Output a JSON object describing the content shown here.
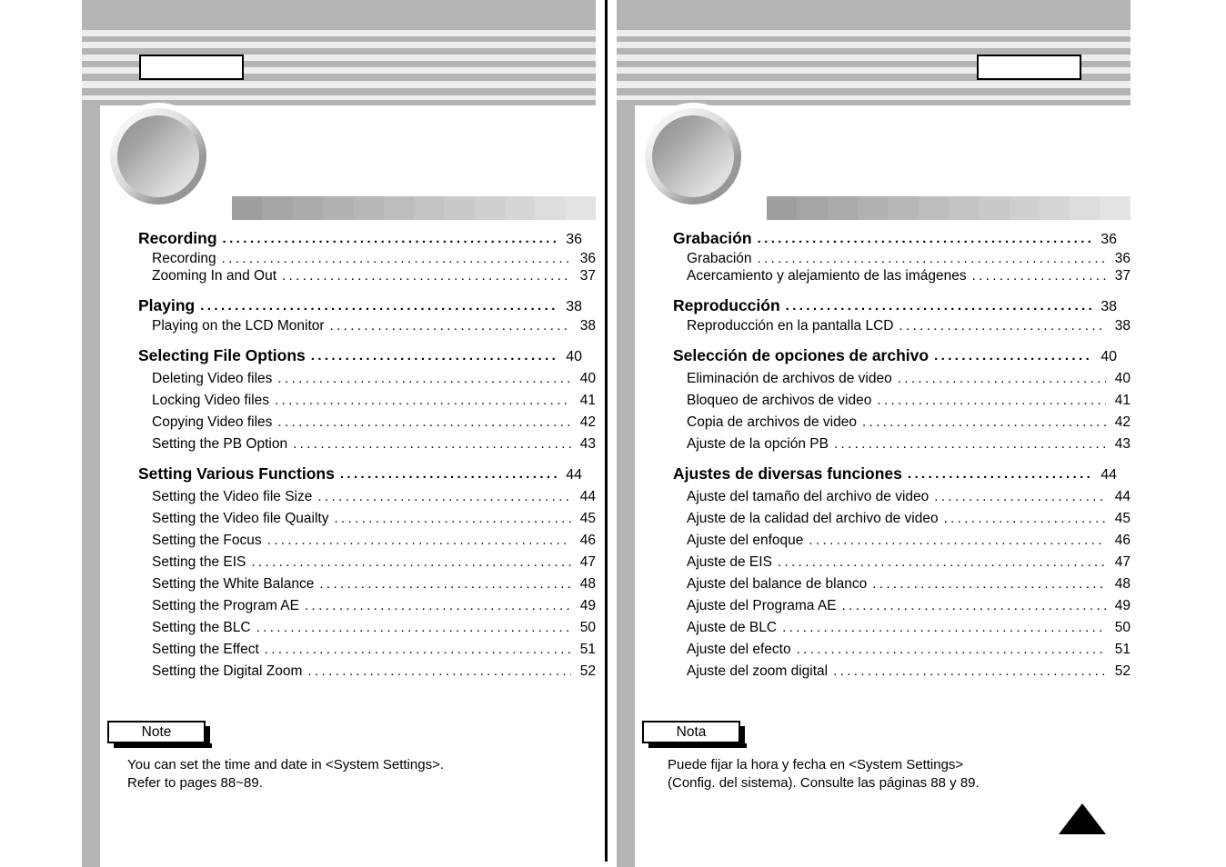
{
  "document": {
    "type": "manual-table-of-contents",
    "colors": {
      "stripe_dark": "#b4b4b4",
      "stripe_light": "#ededed",
      "ink": "#000000",
      "page": "#ffffff"
    }
  },
  "gradient_bar_steps": [
    "#9e9e9e",
    "#a5a5a5",
    "#ababab",
    "#b1b1b1",
    "#b7b7b7",
    "#bdbdbd",
    "#c3c3c3",
    "#c9c9c9",
    "#cfcfcf",
    "#d6d6d6",
    "#dddddd",
    "#e3e3e3"
  ],
  "pages": [
    {
      "id": "left-page",
      "language": "English",
      "header_box_label": "",
      "groups": [
        {
          "main": {
            "label": "Recording",
            "page": "36"
          },
          "subs": [
            {
              "label": "Recording",
              "page": "36"
            },
            {
              "label": "Zooming In and Out",
              "page": "37"
            }
          ]
        },
        {
          "main": {
            "label": "Playing",
            "page": "38"
          },
          "subs": [
            {
              "label": "Playing on the LCD Monitor",
              "page": "38"
            }
          ]
        },
        {
          "main": {
            "label": "Selecting File Options",
            "page": "40"
          },
          "subs": [
            {
              "label": "Deleting Video files",
              "page": "40"
            },
            {
              "label": "Locking Video files",
              "page": "41"
            },
            {
              "label": "Copying Video files",
              "page": "42"
            },
            {
              "label": "Setting the PB Option",
              "page": "43"
            }
          ]
        },
        {
          "main": {
            "label": "Setting Various Functions",
            "page": "44"
          },
          "subs": [
            {
              "label": "Setting the Video file Size",
              "page": "44"
            },
            {
              "label": "Setting the Video file Quailty",
              "page": "45"
            },
            {
              "label": "Setting the Focus",
              "page": "46"
            },
            {
              "label": "Setting the EIS",
              "page": "47"
            },
            {
              "label": "Setting the White Balance",
              "page": "48"
            },
            {
              "label": "Setting the Program AE",
              "page": "49"
            },
            {
              "label": "Setting the BLC",
              "page": "50"
            },
            {
              "label": "Setting the Effect",
              "page": "51"
            },
            {
              "label": "Setting the Digital Zoom",
              "page": "52"
            }
          ]
        }
      ],
      "note": {
        "tab_label": "Note",
        "body": "You can set the time and date in <System Settings>.\nRefer to pages 88~89."
      }
    },
    {
      "id": "right-page",
      "language": "Spanish",
      "header_box_label": "",
      "groups": [
        {
          "main": {
            "label": "Grabación",
            "page": "36"
          },
          "subs": [
            {
              "label": "Grabación",
              "page": "36"
            },
            {
              "label": "Acercamiento y alejamiento de las imágenes",
              "page": "37"
            }
          ]
        },
        {
          "main": {
            "label": "Reproducción",
            "page": "38"
          },
          "subs": [
            {
              "label": "Reproducción en la pantalla LCD",
              "page": "38"
            }
          ]
        },
        {
          "main": {
            "label": "Selección de opciones de archivo",
            "page": "40"
          },
          "subs": [
            {
              "label": "Eliminación de archivos de video",
              "page": "40"
            },
            {
              "label": "Bloqueo de archivos de video",
              "page": "41"
            },
            {
              "label": "Copia de archivos de video",
              "page": "42"
            },
            {
              "label": "Ajuste de la opción PB",
              "page": "43"
            }
          ]
        },
        {
          "main": {
            "label": "Ajustes de diversas funciones",
            "page": "44"
          },
          "subs": [
            {
              "label": "Ajuste del tamaño del archivo de video",
              "page": "44"
            },
            {
              "label": "Ajuste de la calidad del archivo de video",
              "page": "45"
            },
            {
              "label": "Ajuste del enfoque",
              "page": "46"
            },
            {
              "label": "Ajuste de EIS",
              "page": "47"
            },
            {
              "label": "Ajuste del balance de blanco",
              "page": "48"
            },
            {
              "label": "Ajuste del Programa AE",
              "page": "49"
            },
            {
              "label": "Ajuste de BLC",
              "page": "50"
            },
            {
              "label": "Ajuste del efecto",
              "page": "51"
            },
            {
              "label": "Ajuste del zoom digital",
              "page": "52"
            }
          ]
        }
      ],
      "note": {
        "tab_label": "Nota",
        "body": "Puede fijar la hora y fecha en <System Settings>\n(Config. del sistema). Consulte las páginas 88 y 89."
      }
    }
  ]
}
